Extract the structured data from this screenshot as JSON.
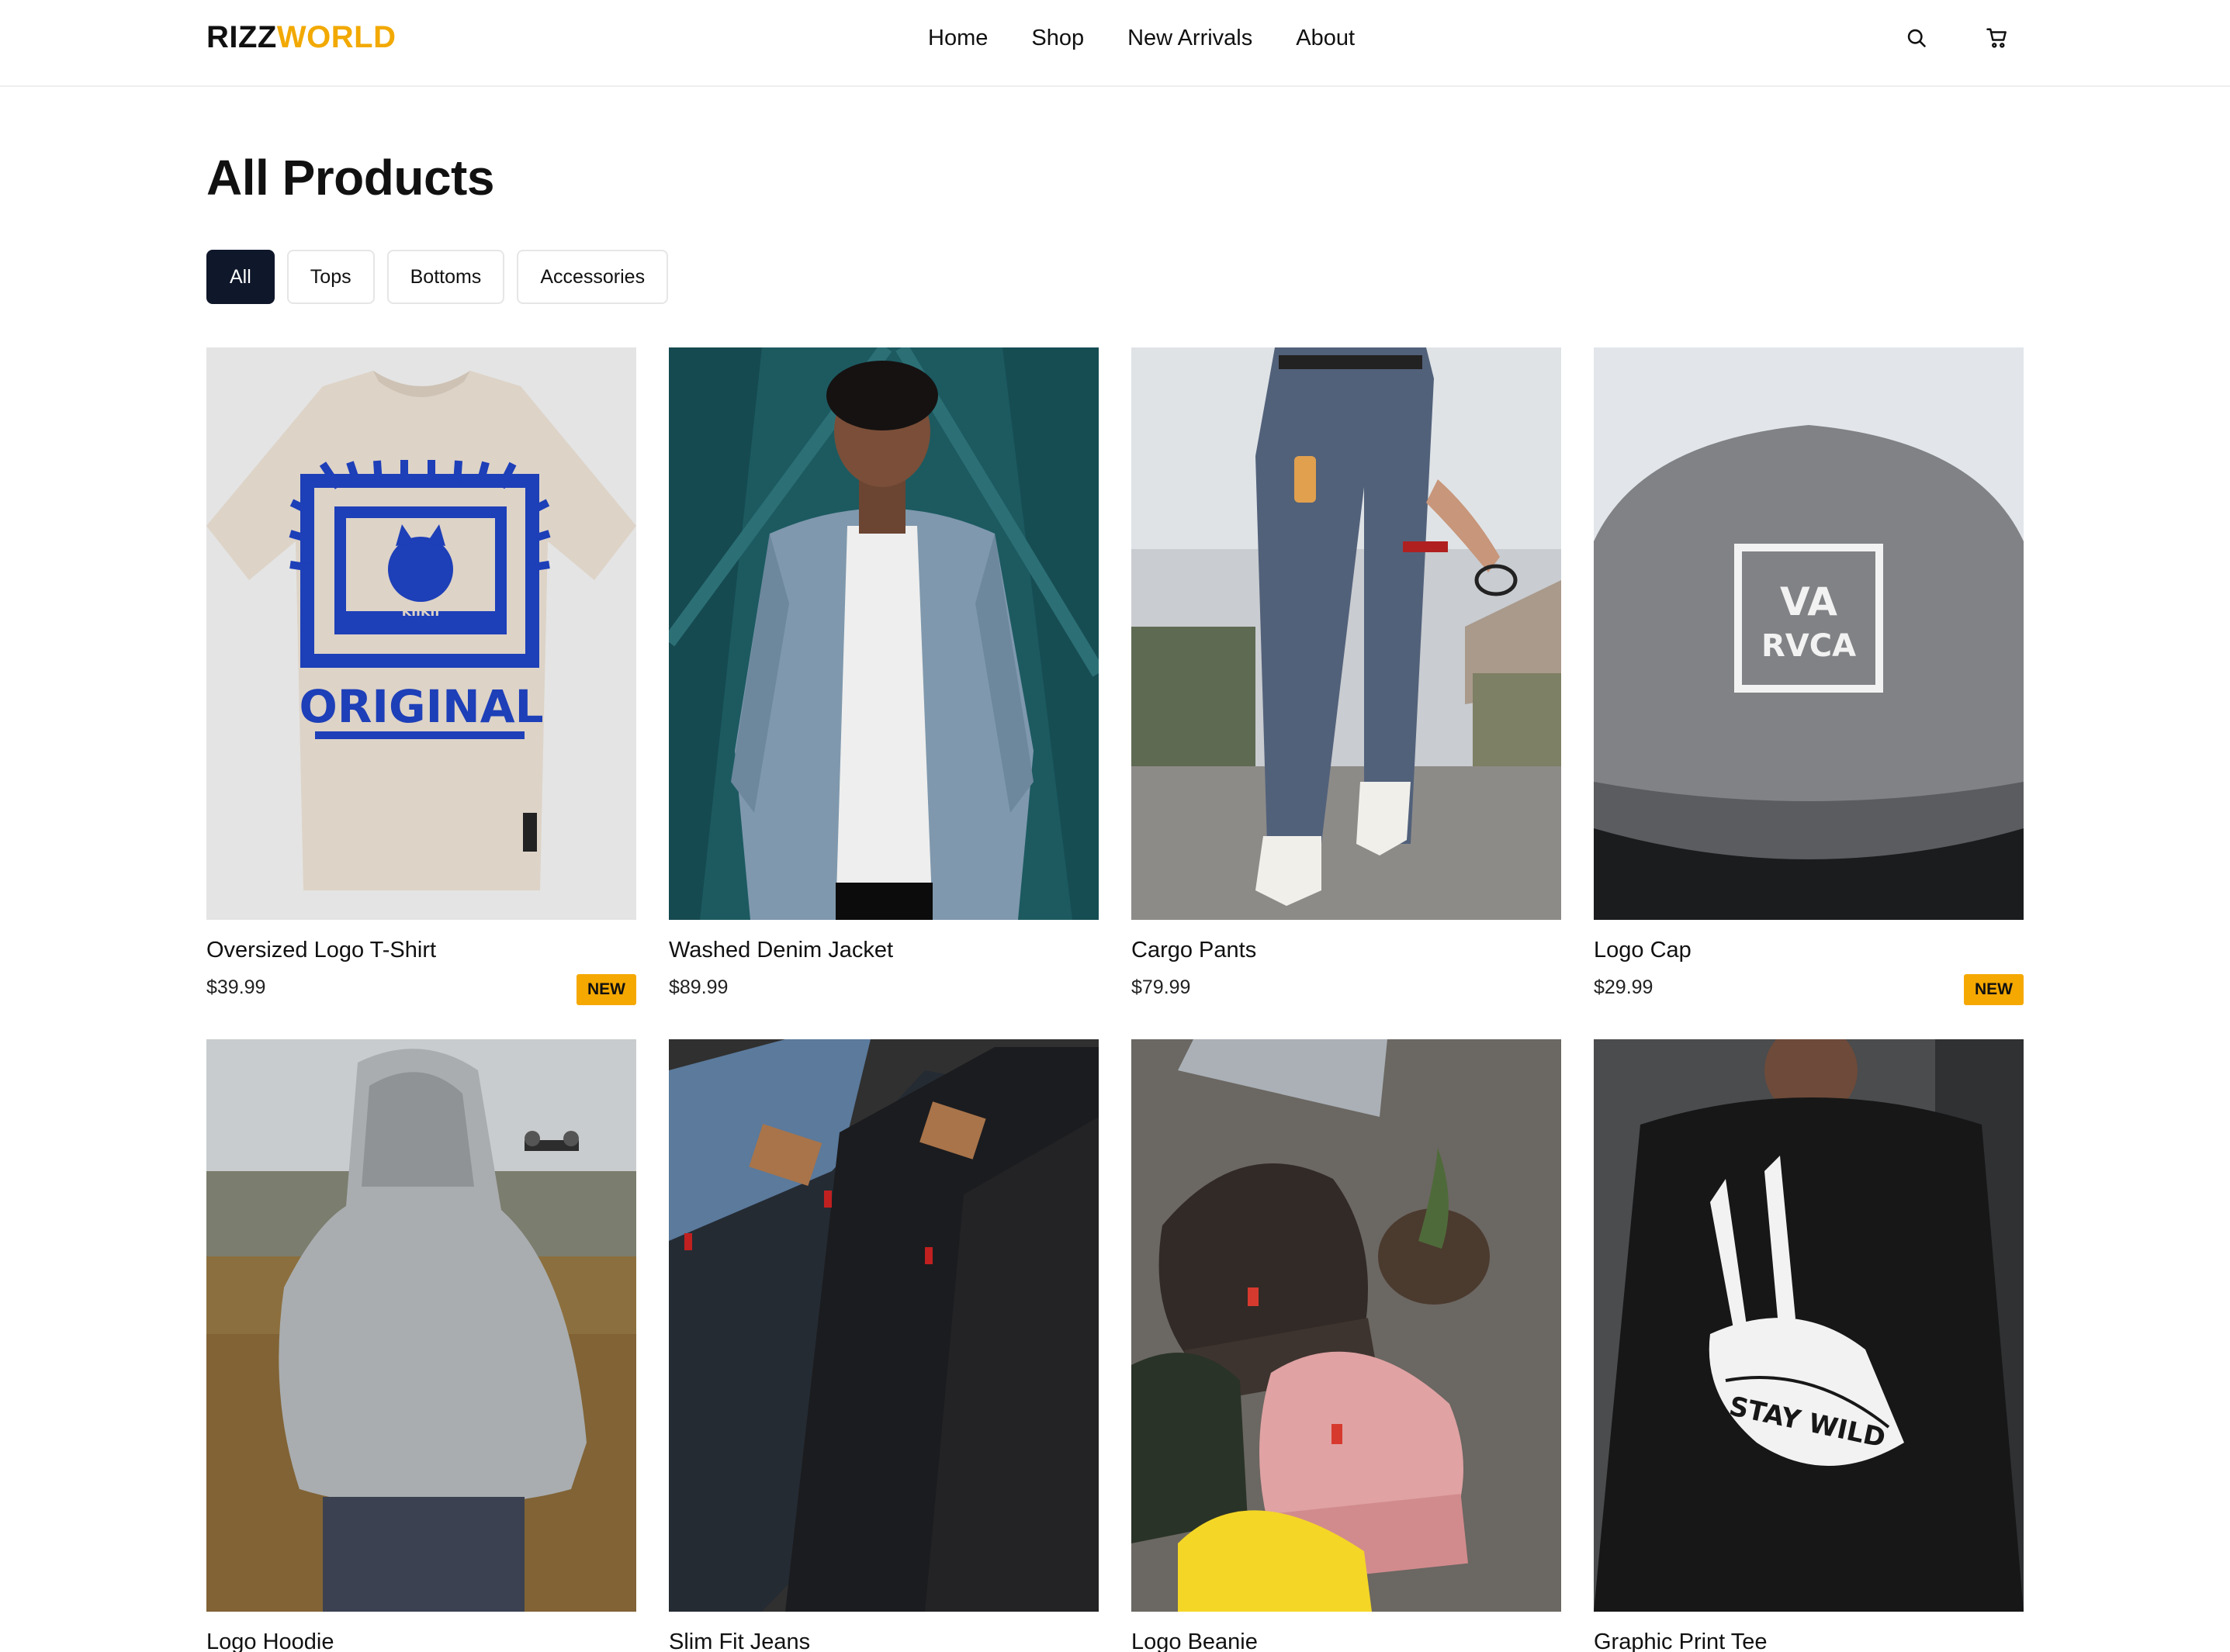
{
  "brand": {
    "part_a": "RIZZ",
    "part_b": "WORLD",
    "accent": "#f2a900"
  },
  "nav": [
    "Home",
    "Shop",
    "New Arrivals",
    "About"
  ],
  "header_icons": [
    "search-icon",
    "cart-icon"
  ],
  "page": {
    "title": "All Products"
  },
  "filters": {
    "items": [
      "All",
      "Tops",
      "Bottoms",
      "Accessories"
    ],
    "selected": "All"
  },
  "products": [
    {
      "name": "Oversized Logo T-Shirt",
      "price": "$39.99",
      "badge": "NEW"
    },
    {
      "name": "Washed Denim Jacket",
      "price": "$89.99",
      "badge": ""
    },
    {
      "name": "Cargo Pants",
      "price": "$79.99",
      "badge": ""
    },
    {
      "name": "Logo Cap",
      "price": "$29.99",
      "badge": "NEW"
    },
    {
      "name": "Logo Hoodie",
      "price": "",
      "badge": ""
    },
    {
      "name": "Slim Fit Jeans",
      "price": "",
      "badge": ""
    },
    {
      "name": "Logo Beanie",
      "price": "",
      "badge": ""
    },
    {
      "name": "Graphic Print Tee",
      "price": "",
      "badge": ""
    }
  ],
  "product_images": {
    "tshirt_print_top": "KIIKII",
    "tshirt_print_main": "ORIGINAL",
    "cap_logo_top": "VA",
    "cap_logo_bottom": "RVCA",
    "tee_print": "STAY WILD"
  },
  "colors": {
    "badge": "#f5a800",
    "active_chip": "#0f172a"
  }
}
